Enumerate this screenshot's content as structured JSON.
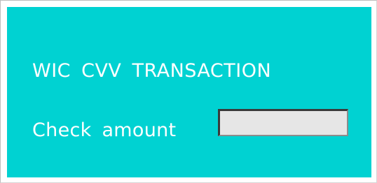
{
  "dialog": {
    "title": "WIC CVV TRANSACTION",
    "check_amount_label": "Check amount",
    "check_amount_value": ""
  },
  "colors": {
    "panel_background": "#00d2d2",
    "text": "#ffffff",
    "input_background": "#e6e6e6"
  }
}
